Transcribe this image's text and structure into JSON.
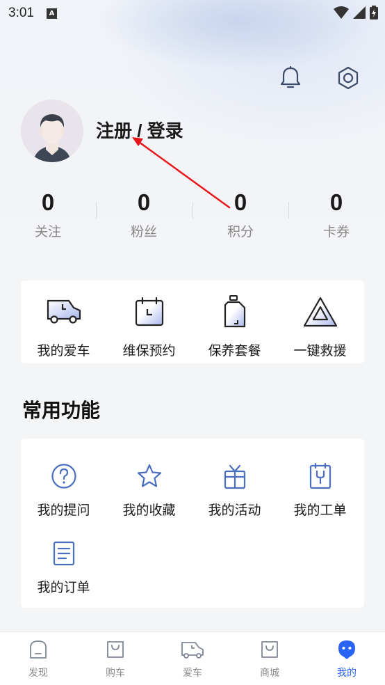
{
  "status_bar": {
    "time": "3:01",
    "notification_letter": "A"
  },
  "profile": {
    "login_text": "注册 / 登录"
  },
  "stats": [
    {
      "value": "0",
      "label": "关注"
    },
    {
      "value": "0",
      "label": "粉丝"
    },
    {
      "value": "0",
      "label": "积分"
    },
    {
      "value": "0",
      "label": "卡券"
    }
  ],
  "quick_actions": [
    {
      "label": "我的爱车",
      "icon": "car-icon"
    },
    {
      "label": "维保预约",
      "icon": "calendar-clock-icon"
    },
    {
      "label": "保养套餐",
      "icon": "oil-bottle-icon"
    },
    {
      "label": "一键救援",
      "icon": "warning-triangle-icon"
    }
  ],
  "common_functions": {
    "title": "常用功能",
    "items": [
      {
        "label": "我的提问",
        "icon": "question-icon"
      },
      {
        "label": "我的收藏",
        "icon": "star-icon"
      },
      {
        "label": "我的活动",
        "icon": "gift-icon"
      },
      {
        "label": "我的工单",
        "icon": "work-order-icon"
      },
      {
        "label": "我的订单",
        "icon": "order-list-icon"
      }
    ]
  },
  "tabbar": {
    "items": [
      {
        "label": "发现",
        "icon": "discover-icon",
        "active": false
      },
      {
        "label": "购车",
        "icon": "shopping-bag-icon",
        "active": false
      },
      {
        "label": "爱车",
        "icon": "car-tab-icon",
        "active": false
      },
      {
        "label": "商城",
        "icon": "mall-bag-icon",
        "active": false
      },
      {
        "label": "我的",
        "icon": "profile-icon",
        "active": true
      }
    ]
  },
  "colors": {
    "accent": "#2a64f6",
    "icon_blue": "#4a6fbf",
    "annotation_red": "#e8141b"
  }
}
